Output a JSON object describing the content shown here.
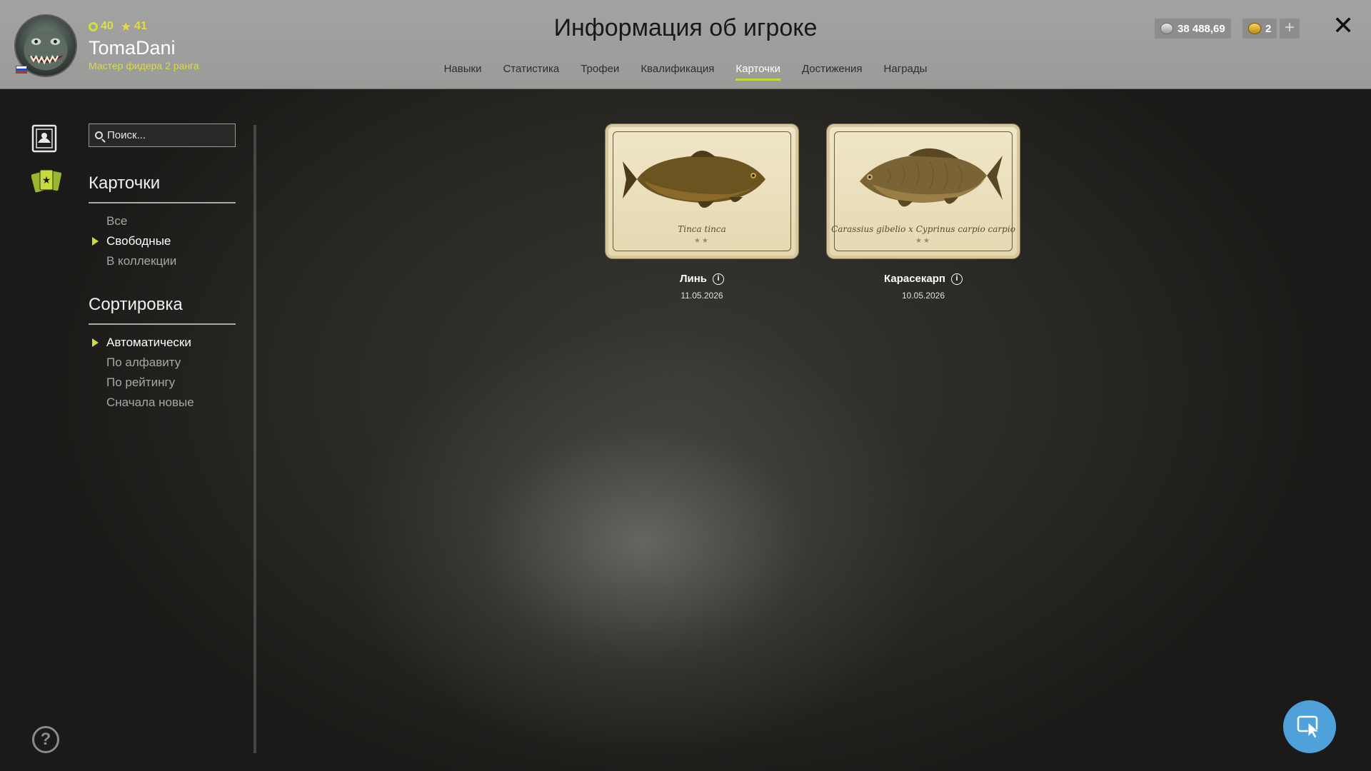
{
  "header": {
    "title": "Информация об игроке",
    "player": {
      "level": "40",
      "rank": "41",
      "username": "TomaDani",
      "subtitle": "Мастер фидера 2 ранга"
    },
    "currency": {
      "silver": "38 488,69",
      "gold": "2"
    },
    "tabs": [
      "Навыки",
      "Статистика",
      "Трофеи",
      "Квалификация",
      "Карточки",
      "Достижения",
      "Награды"
    ],
    "active_tab": "Карточки"
  },
  "sidebar": {
    "search_placeholder": "Поиск...",
    "cards_section": {
      "title": "Карточки",
      "items": [
        "Все",
        "Свободные",
        "В коллекции"
      ],
      "active": "Свободные"
    },
    "sort_section": {
      "title": "Сортировка",
      "items": [
        "Автоматически",
        "По алфавиту",
        "По рейтингу",
        "Сначала новые"
      ],
      "active": "Автоматически"
    }
  },
  "cards": [
    {
      "name": "Линь",
      "latin": "Tinca tinca",
      "date": "11.05.2026",
      "stars": "★★"
    },
    {
      "name": "Карасекарп",
      "latin": "Carassius gibelio x Cyprinus carpio carpio",
      "date": "10.05.2026",
      "stars": "★★"
    }
  ],
  "icons": {
    "nav": [
      "player-card-icon",
      "cards-icon"
    ],
    "help": "help-icon",
    "fab": "cursor-icon",
    "close": "close-icon"
  },
  "colors": {
    "accent": "#c6d83a",
    "fab": "#4fa1d9",
    "header": "#9e9e9c"
  }
}
